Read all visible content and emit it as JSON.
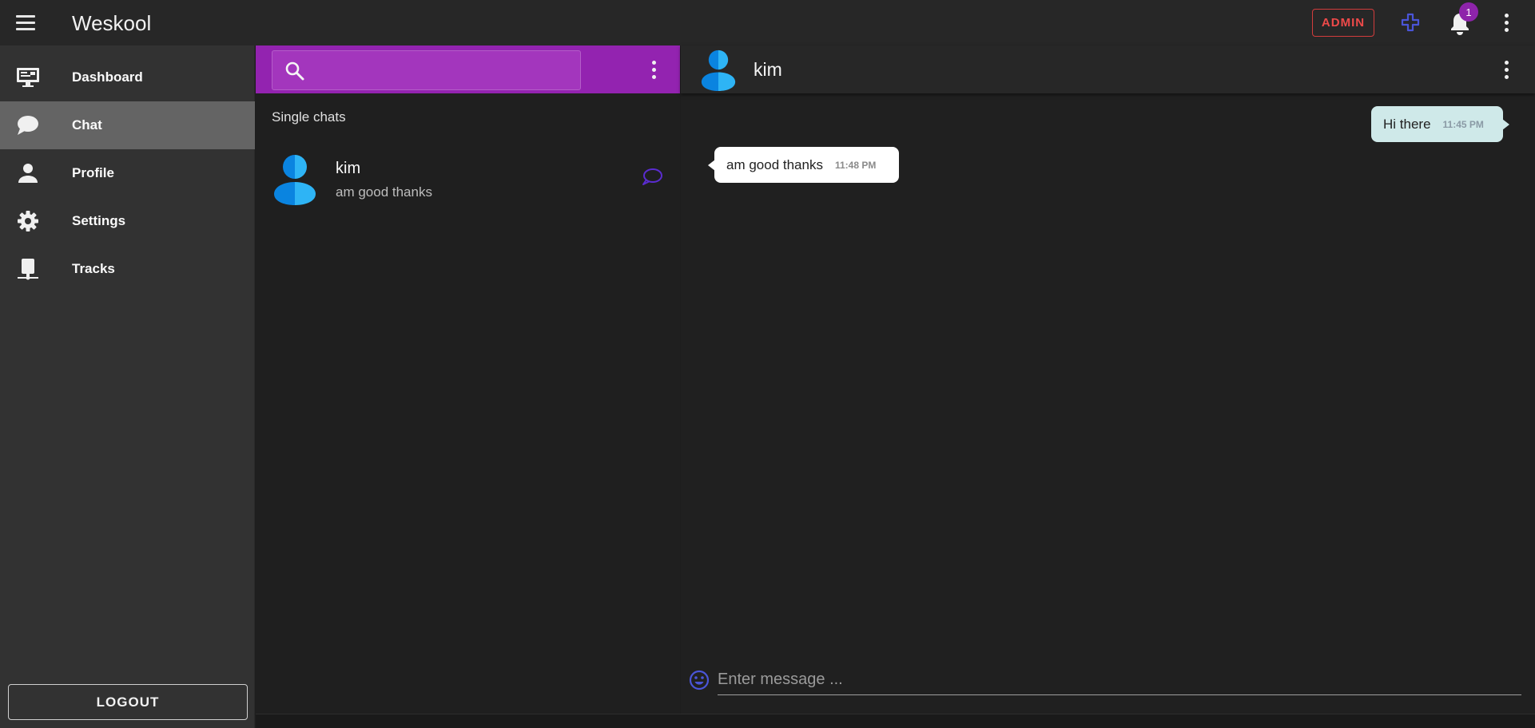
{
  "app": {
    "title": "Weskool"
  },
  "topbar": {
    "admin_label": "ADMIN",
    "notification_count": "1"
  },
  "sidebar": {
    "items": [
      {
        "label": "Dashboard",
        "icon": "monitor-icon",
        "active": false
      },
      {
        "label": "Chat",
        "icon": "chat-bubble-icon",
        "active": true
      },
      {
        "label": "Profile",
        "icon": "person-icon",
        "active": false
      },
      {
        "label": "Settings",
        "icon": "gear-icon",
        "active": false
      },
      {
        "label": "Tracks",
        "icon": "tracks-icon",
        "active": false
      }
    ],
    "logout_label": "LOGOUT"
  },
  "chat_list": {
    "search_placeholder": "",
    "section_title": "Single chats",
    "chats": [
      {
        "name": "kim",
        "preview": "am good thanks"
      }
    ]
  },
  "conversation": {
    "contact_name": "kim",
    "messages": [
      {
        "direction": "outgoing",
        "text": "Hi there",
        "time": "11:45 PM"
      },
      {
        "direction": "incoming",
        "text": "am good thanks",
        "time": "11:48 PM"
      }
    ],
    "input_placeholder": "Enter message ..."
  },
  "colors": {
    "accent_purple": "#9323b0",
    "admin_red": "#ee4a4a",
    "avatar_blue": "#1e9ae8",
    "outgoing_bubble": "#cfe9e9"
  }
}
